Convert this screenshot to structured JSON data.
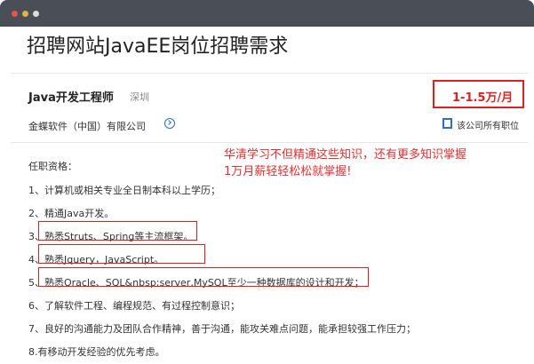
{
  "window": {
    "title_dots": [
      "close",
      "minimize",
      "maximize"
    ]
  },
  "page": {
    "title": "招聘网站JavaEE岗位招聘需求"
  },
  "job": {
    "title": "Java开发工程师",
    "city": "深圳",
    "salary": "1-1.5万/月",
    "company": "金蝶软件（中国）有限公司",
    "all_jobs_label": "该公司所有职位"
  },
  "requirements": {
    "heading": "任职资格：",
    "items": [
      "1、计算机或相关专业全日制本科以上学历；",
      "2、精通Java开发。",
      "3、熟悉Struts、Spring等主流框架。",
      "4、熟悉Jquery，JavaScript。",
      "5、熟悉Oracle、SQL&nbsp;server,MySQL至少一种数据库的设计和开发；",
      "6、了解软件工程、编程规范、有过程控制意识；",
      "7、良好的沟通能力及团队合作精神，善于沟通，能攻关难点问题，能承担较强工作压力；",
      "8.有移动开发经验的优先考虑。"
    ]
  },
  "promo": {
    "line1": "华清学习不但精通这些知识，还有更多知识掌握",
    "line2": "1万月薪轻轻松松就掌握!"
  },
  "colors": {
    "titlebar": "#4a4e57",
    "highlight_red": "#e02020",
    "link_blue": "#2e6fbf"
  }
}
